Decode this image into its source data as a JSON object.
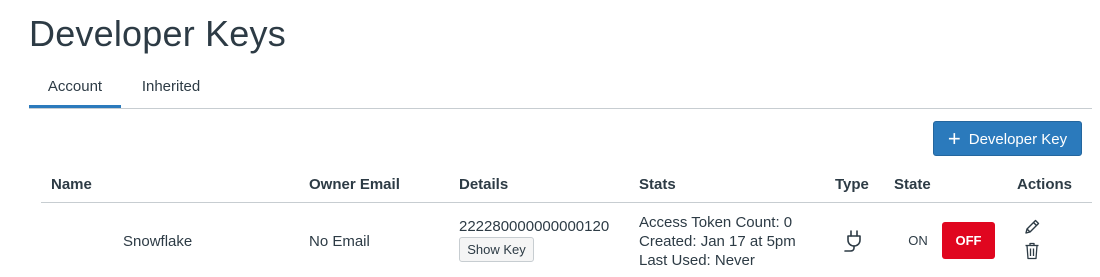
{
  "page": {
    "title": "Developer Keys"
  },
  "tabs": [
    {
      "label": "Account",
      "selected": true
    },
    {
      "label": "Inherited",
      "selected": false
    }
  ],
  "toolbar": {
    "add_key_label": "Developer Key",
    "add_key_icon": "plus-icon"
  },
  "table": {
    "columns": [
      "Name",
      "Owner Email",
      "Details",
      "Stats",
      "Type",
      "State",
      "Actions"
    ],
    "rows": [
      {
        "name": "Snowflake",
        "owner_email": "No Email",
        "details_id": "222280000000000120",
        "show_key_label": "Show Key",
        "stats": {
          "access_token_count": "Access Token Count: 0",
          "created": "Created: Jan 17 at 5pm",
          "last_used": "Last Used: Never"
        },
        "type_icon": "plug-icon",
        "state_on_label": "ON",
        "state_off_label": "OFF",
        "state_selected": "OFF",
        "actions": [
          "edit-icon",
          "trash-icon"
        ]
      }
    ]
  },
  "colors": {
    "accent": "#2b7abc",
    "off_active": "#e0061f",
    "text": "#2d3b45",
    "divider": "#c7cdd1"
  }
}
